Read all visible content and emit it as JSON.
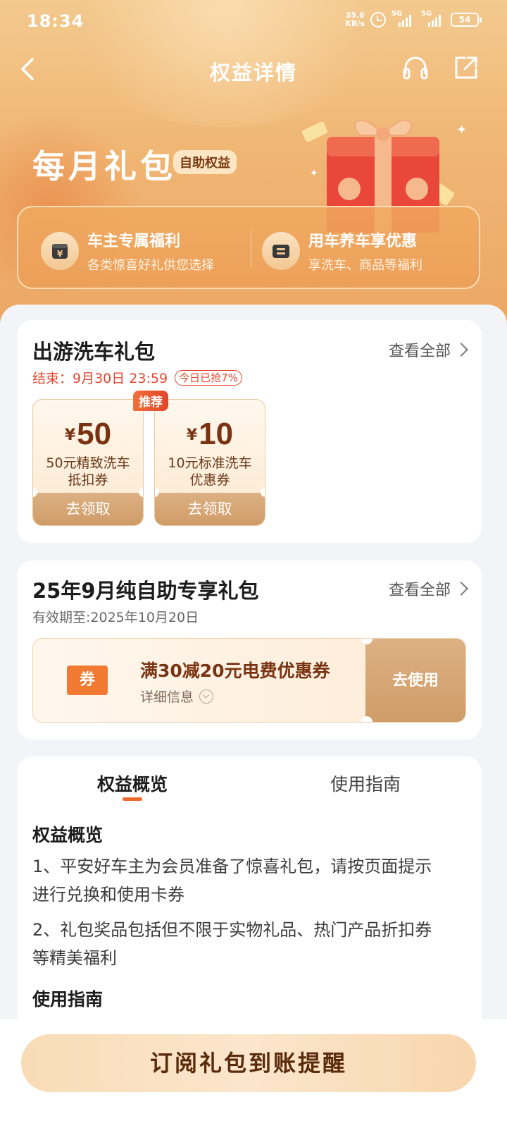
{
  "status_bar": {
    "time": "18:34",
    "net_speed_value": "35.6",
    "net_speed_unit": "KB/s",
    "sim1": "5G",
    "sim2": "5G",
    "battery": "54"
  },
  "nav": {
    "title": "权益详情",
    "back_icon": "back-arrow-icon",
    "service_icon": "headset-icon",
    "share_icon": "share-icon"
  },
  "hero": {
    "title": "每月礼包",
    "badge": "自助权益",
    "benefits": [
      {
        "title": "车主专属福利",
        "subtitle": "各类惊喜好礼供您选择",
        "icon": "yuan-wallet-icon"
      },
      {
        "title": "用车养车享优惠",
        "subtitle": "享洗车、商品等福利",
        "icon": "ticket-icon"
      }
    ]
  },
  "package1": {
    "title": "出游洗车礼包",
    "view_all": "查看全部",
    "end_label": "结束：9月30日 23:59",
    "grab_badge": "今日已抢7%",
    "recommend_tag": "推荐",
    "coupons": [
      {
        "currency": "¥",
        "amount": "50",
        "desc_line1": "50元精致洗车",
        "desc_line2": "抵扣券",
        "button": "去领取"
      },
      {
        "currency": "¥",
        "amount": "10",
        "desc_line1": "10元标准洗车",
        "desc_line2": "优惠券",
        "button": "去领取"
      }
    ]
  },
  "package2": {
    "title": "25年9月纯自助专享礼包",
    "view_all": "查看全部",
    "valid": "有效期至:2025年10月20日",
    "ticket": {
      "icon_label": "券",
      "title": "满30减20元电费优惠券",
      "detail": "详细信息",
      "button": "去使用"
    }
  },
  "info": {
    "tabs": [
      "权益概览",
      "使用指南"
    ],
    "active_tab": 0,
    "overview_heading": "权益概览",
    "overview_line1a": "1、平安好车主为会员准备了惊喜礼包，请按页面提示",
    "overview_line1b": "进行兑换和使用卡券",
    "overview_line2a": "2、礼包奖品包括但不限于实物礼品、热门产品折扣券",
    "overview_line2b": "等精美福利",
    "guide_heading": "使用指南"
  },
  "bottom": {
    "subscribe_button": "订阅礼包到账提醒"
  },
  "colors": {
    "accent": "#ee6a2c",
    "brand_gold": "#cf9c68",
    "warning_red": "#e3462f"
  }
}
